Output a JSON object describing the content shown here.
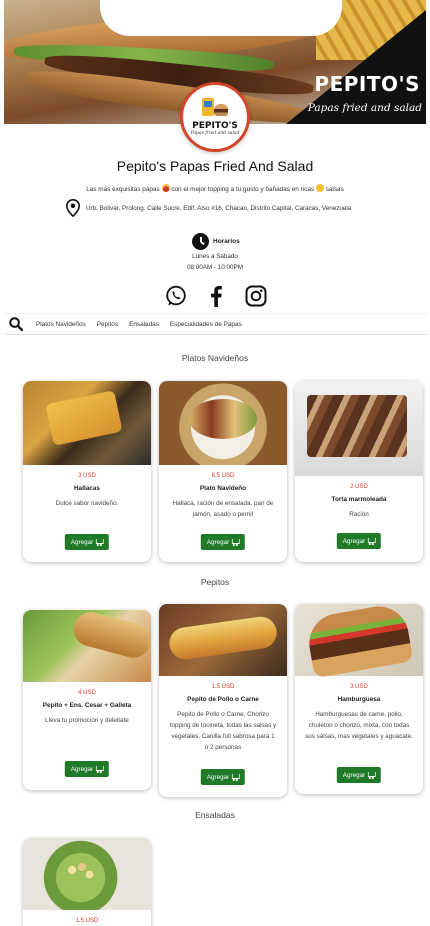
{
  "store": {
    "name": "Pepito's Papas Fried And Salad",
    "tagline_part1": "Las más exquisitas papas",
    "tagline_part2": "con el mejor topping a tu gusto y bañadas en ricas",
    "tagline_part3": "salsas",
    "address": "Urb. Bolivar, Prolong. Calle Sucre, Edif. Also #16, Chacao, Distrito Capital, Caracas, Venezuela",
    "hours_label": "Horarios",
    "hours_days": "Lunes a Sábado",
    "hours_time": "08:00AM - 10:00PM"
  },
  "banner": {
    "brand": "PEPITO'S",
    "subtitle": "Papas fried and salad"
  },
  "logo": {
    "name": "PEPITO'S",
    "subtitle": "Papas fried and salad"
  },
  "social": [
    "whatsapp-icon",
    "facebook-icon",
    "instagram-icon"
  ],
  "categories": [
    "Platos Navideños",
    "Pepitos",
    "Ensaladas",
    "Especialidades de Papas"
  ],
  "sections": [
    {
      "title": "Platos Navideños",
      "products": [
        {
          "price": "3 USD",
          "name": "Hallacas",
          "desc": "Dulce sabor navideño.",
          "button": "Agregar"
        },
        {
          "price": "8.5 USD",
          "name": "Plato Navideño",
          "desc": "Hallaca, ración de ensalada, pan de jamón, asado o pernil",
          "button": "Agregar"
        },
        {
          "price": "2 USD",
          "name": "Torta marmoleada",
          "desc": "Ración",
          "button": "Agregar"
        }
      ]
    },
    {
      "title": "Pepitos",
      "products": [
        {
          "price": "4 USD",
          "name": "Pepito + Ens. Cesar + Galleta",
          "desc": "Lleva tu promoción y deleitate",
          "button": "Agregar"
        },
        {
          "price": "1.5 USD",
          "name": "Pepito de Pollo o Carne",
          "desc": "Pepito de Pollo o Carne, Chorizo topping de tocineta, todas las salsas y vegetales. Canilla full sabrosa para 1 o 2 personas",
          "button": "Agregar"
        },
        {
          "price": "3 USD",
          "name": "Hamburguesa",
          "desc": "Hamburguesas de carne, pollo, chuleton o chorizo, mixta, con todas sus salsas, mas vegetales y aguacate.",
          "button": "Agregar"
        }
      ]
    },
    {
      "title": "Ensaladas",
      "products": [
        {
          "price": "1.5 USD"
        }
      ]
    }
  ],
  "colors": {
    "accent_green": "#1f7a27",
    "price_red": "#d63a2b",
    "logo_ring": "#d2462a"
  }
}
